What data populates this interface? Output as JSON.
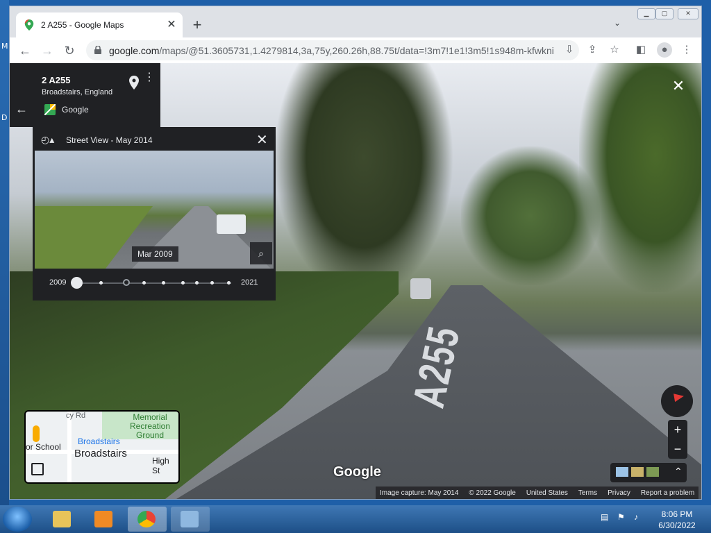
{
  "desktop": {
    "edge_letters": [
      "M",
      "D"
    ]
  },
  "browser": {
    "tab_title": "2 A255 - Google Maps",
    "url_host": "google.com",
    "url_path": "/maps/@51.3605731,1.4279814,3a,75y,260.26h,88.75t/data=!3m7!1e1!3m5!1s948m-kfwkni..."
  },
  "place_card": {
    "name": "2 A255",
    "locality": "Broadstairs, England",
    "provider": "Google"
  },
  "timeline": {
    "title": "Street View - May 2014",
    "thumbnail_date": "Mar 2009",
    "start_year": "2009",
    "end_year": "2021",
    "selected_fraction": 0.0
  },
  "road_marking": "A255",
  "minimap": {
    "park_label": "Memorial Recreation Ground",
    "road_label_1": "cy Rd",
    "school_label": "or School",
    "station_label": "Broadstairs",
    "town_label": "Broadstairs",
    "street_label": "High St"
  },
  "watermark": "Google",
  "footer": {
    "capture": "Image capture: May 2014",
    "copyright": "© 2022 Google",
    "region": "United States",
    "terms": "Terms",
    "privacy": "Privacy",
    "report": "Report a problem"
  },
  "taskbar": {
    "time": "8:06 PM",
    "date": "6/30/2022"
  },
  "colors": {
    "accent": "#1a73e8",
    "panel": "#202124",
    "compass_needle": "#e53935"
  }
}
